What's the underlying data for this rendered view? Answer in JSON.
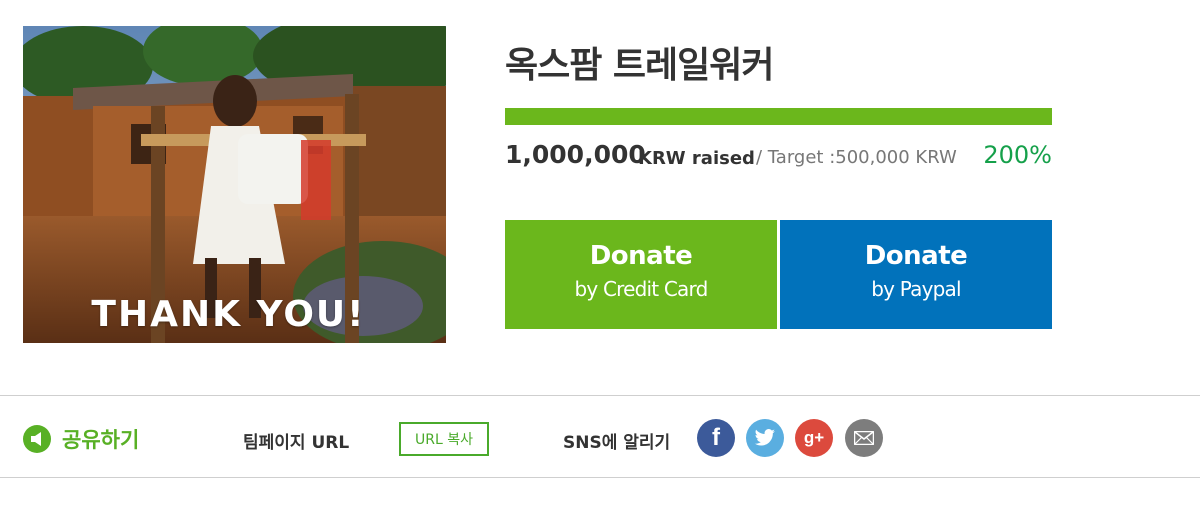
{
  "campaign": {
    "image_caption": "THANK YOU!",
    "title": "옥스팜 트레일워커",
    "raised_amount": "1,000,000",
    "raised_label": "KRW raised",
    "target_text": "/ Target :500,000 KRW",
    "percent_text": "200%",
    "progress_fraction": 1.0
  },
  "donate": {
    "credit_card": {
      "main": "Donate",
      "sub": "by Credit Card"
    },
    "paypal": {
      "main": "Donate",
      "sub": "by Paypal"
    }
  },
  "share": {
    "label": "공유하기",
    "team_url_label": "팀페이지 URL",
    "copy_button": "URL 복사",
    "sns_label": "SNS에 알리기",
    "icons": [
      "megaphone-icon",
      "facebook-icon",
      "twitter-icon",
      "google-plus-icon",
      "mail-icon"
    ]
  },
  "colors": {
    "green": "#6bb71c",
    "blue": "#0172bb",
    "percent_green": "#15a04a",
    "share_green": "#58b025",
    "facebook": "#3c5a9a",
    "twitter": "#5aaee0",
    "google_plus": "#dc4a3d",
    "mail": "#7d7d7d"
  }
}
